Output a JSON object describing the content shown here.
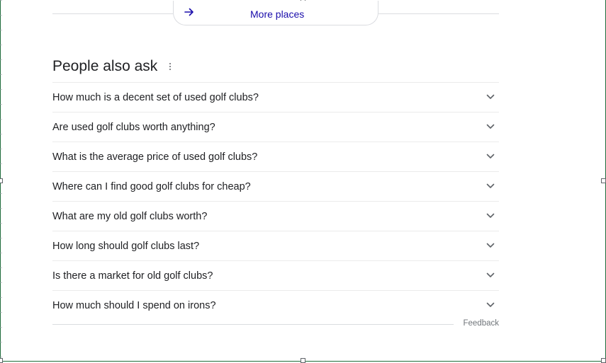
{
  "more_places": {
    "label": "More places",
    "icon": "arrow-right-icon",
    "accent_color": "#1a0dab"
  },
  "people_also_ask": {
    "title": "People also ask",
    "menu_icon": "more-vert-icon",
    "questions": [
      {
        "text": "How much is a decent set of used golf clubs?"
      },
      {
        "text": "Are used golf clubs worth anything?"
      },
      {
        "text": "What is the average price of used golf clubs?"
      },
      {
        "text": "Where can I find good golf clubs for cheap?"
      },
      {
        "text": "What are my old golf clubs worth?"
      },
      {
        "text": "How long should golf clubs last?"
      },
      {
        "text": "Is there a market for old golf clubs?"
      },
      {
        "text": "How much should I spend on irons?"
      }
    ],
    "expand_icon": "chevron-down-icon"
  },
  "footer": {
    "feedback_label": "Feedback"
  }
}
